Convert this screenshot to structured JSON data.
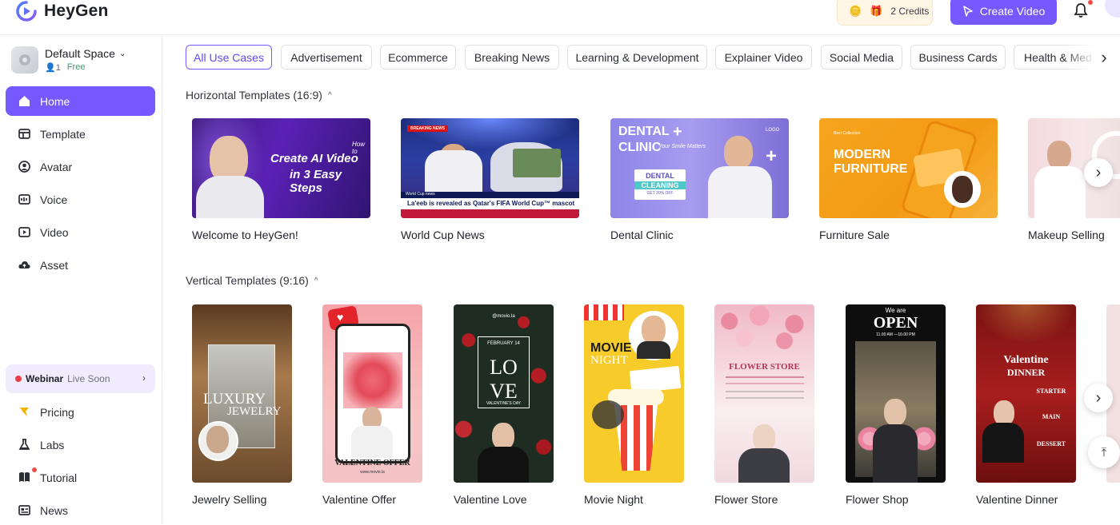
{
  "app": {
    "name": "HeyGen"
  },
  "header": {
    "credits": "2 Credits",
    "create_label": "Create Video",
    "accent": "#7559ff"
  },
  "space": {
    "name": "Default Space",
    "members": "1",
    "plan": "Free"
  },
  "sidebar": {
    "items": [
      {
        "label": "Home",
        "icon": "home-icon"
      },
      {
        "label": "Template",
        "icon": "template-icon"
      },
      {
        "label": "Avatar",
        "icon": "avatar-icon"
      },
      {
        "label": "Voice",
        "icon": "voice-icon"
      },
      {
        "label": "Video",
        "icon": "video-icon"
      },
      {
        "label": "Asset",
        "icon": "asset-icon"
      }
    ],
    "webinar": {
      "label": "Webinar",
      "status": "Live Soon"
    },
    "bottom_items": [
      {
        "label": "Pricing",
        "icon": "pricing-icon"
      },
      {
        "label": "Labs",
        "icon": "labs-icon"
      },
      {
        "label": "Tutorial",
        "icon": "tutorial-icon"
      },
      {
        "label": "News",
        "icon": "news-icon"
      }
    ]
  },
  "filters": [
    "All Use Cases",
    "Advertisement",
    "Ecommerce",
    "Breaking News",
    "Learning & Development",
    "Explainer Video",
    "Social Media",
    "Business Cards",
    "Health & Med"
  ],
  "horizontal": {
    "title": "Horizontal Templates (16:9)",
    "cards": [
      {
        "label": "Welcome to HeyGen!",
        "line1": "How to",
        "line2": "Create AI Video",
        "line3": "in 3 Easy Steps"
      },
      {
        "label": "World Cup News",
        "tag": "BREAKING NEWS",
        "ticker": "La'eeb is revealed as Qatar's FIFA World Cup™ mascot",
        "sub": "World Cup news"
      },
      {
        "label": "Dental Clinic",
        "line1": "DENTAL",
        "line2": "CLINIC",
        "tagline": "Your Smile Matters",
        "box1": "DENTAL",
        "box2": "CLEANING",
        "box3": "GET 20% OFF",
        "logo": "LOGO"
      },
      {
        "label": "Furniture Sale",
        "kicker": "Best Collection",
        "line1": "MODERN",
        "line2": "FURNITURE"
      },
      {
        "label": "Makeup Selling"
      }
    ]
  },
  "vertical": {
    "title": "Vertical Templates (9:16)",
    "cards": [
      {
        "label": "Jewelry Selling",
        "line1": "LUXURY",
        "line2": "JEWELRY"
      },
      {
        "label": "Valentine Offer",
        "line1": "VALENTINE OFFER",
        "line2": "www.movio.la"
      },
      {
        "label": "Valentine Love",
        "handle": "@movio.la",
        "date": "FEBRUARY 14",
        "l1": "LO",
        "l2": "VE",
        "sub": "VALENTINE'S DAY"
      },
      {
        "label": "Movie Night",
        "l1": "MOVIE",
        "l2": "NIGHT"
      },
      {
        "label": "Flower Store",
        "l1": "FLOWER STORE"
      },
      {
        "label": "Flower Shop",
        "l0": "We are",
        "l1": "OPEN",
        "hours": "11.00 AM —10.00 PM"
      },
      {
        "label": "Valentine Dinner",
        "l1": "Valentine",
        "l2": "DINNER",
        "m1": "STARTER",
        "m2": "MAIN",
        "m3": "DESSERT"
      }
    ]
  }
}
